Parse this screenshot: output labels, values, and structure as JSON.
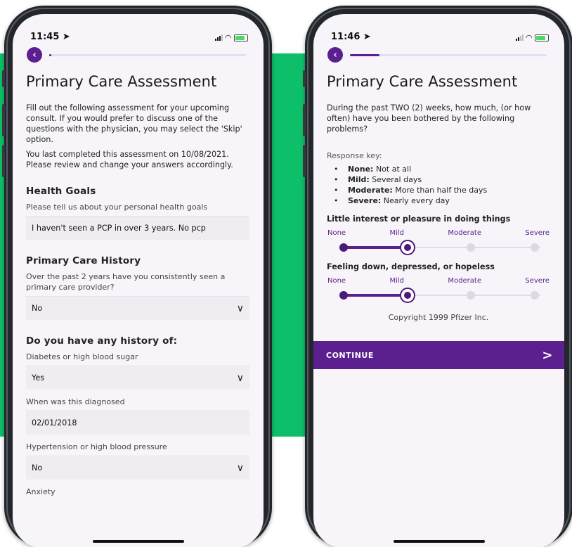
{
  "left_screen": {
    "status": {
      "time": "11:45"
    },
    "progress_fraction": 0.01,
    "title": "Primary Care Assessment",
    "intro": "Fill out the following assessment for your upcoming consult. If you would prefer to discuss one of the questions with the physician, you may select the 'Skip' option.",
    "last_completed": "You last completed this assessment on 10/08/2021. Please review and change your answers accordingly.",
    "health_goals": {
      "heading": "Health Goals",
      "label": "Please tell us about your personal health goals",
      "value": "I haven't seen a PCP in over 3 years. No pcp"
    },
    "primary_care_history": {
      "heading": "Primary Care History",
      "label": "Over the past 2 years have you consistently seen a primary care provider?",
      "value": "No"
    },
    "history": {
      "heading": "Do you have any history of:",
      "diabetes_label": "Diabetes or high blood sugar",
      "diabetes_value": "Yes",
      "diagnosed_label": "When was this diagnosed",
      "diagnosed_value": "02/01/2018",
      "hypertension_label": "Hypertension or high blood pressure",
      "hypertension_value": "No",
      "anxiety_label": "Anxiety"
    }
  },
  "right_screen": {
    "status": {
      "time": "11:46"
    },
    "progress_fraction": 0.15,
    "title": "Primary Care Assessment",
    "intro": "During the past TWO (2) weeks, how much, (or how often) have you been bothered by the following problems?",
    "response_key_title": "Response key:",
    "response_key": [
      {
        "term": "None:",
        "desc": " Not at all"
      },
      {
        "term": "Mild:",
        "desc": " Several days"
      },
      {
        "term": "Moderate:",
        "desc": " More than half the days"
      },
      {
        "term": "Severe:",
        "desc": " Nearly every day"
      }
    ],
    "scale_labels": [
      "None",
      "Mild",
      "Moderate",
      "Severe"
    ],
    "questions": [
      {
        "text": "Little interest or pleasure in doing things",
        "selected": "Mild"
      },
      {
        "text": "Feeling down, depressed, or hopeless",
        "selected": "Mild"
      }
    ],
    "copyright": "Copyright 1999 Pfizer Inc.",
    "continue_label": "CONTINUE"
  },
  "colors": {
    "brand_purple": "#5b1f8f",
    "background_green": "#0dbf68"
  },
  "icons": [
    "back-icon",
    "location-arrow-icon",
    "signal-icon",
    "wifi-icon",
    "battery-icon",
    "chevron-down-icon",
    "chevron-right-icon"
  ]
}
